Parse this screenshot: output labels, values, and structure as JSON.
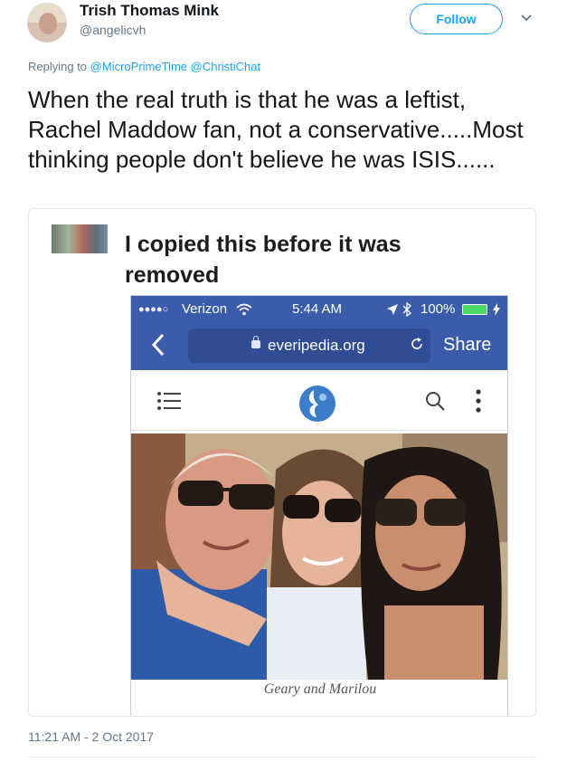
{
  "author": {
    "name": "Trish Thomas Mink",
    "handle": "@angelicvh"
  },
  "follow_label": "Follow",
  "replying": {
    "prefix": "Replying to",
    "users": [
      "@MicroPrimeTime",
      "@ChristiChat"
    ]
  },
  "tweet": {
    "text": "When the real truth is that he was a leftist, Rachel Maddow fan, not a conservative.....Most thinking people don't believe he was ISIS......",
    "timestamp": "11:21 AM - 2 Oct 2017"
  },
  "media": {
    "caption": "I copied this before it was removed",
    "phone": {
      "carrier": "Verizon",
      "signal_dots": "●●●●○",
      "time": "5:44 AM",
      "battery": "100%",
      "url": "everipedia.org",
      "share_label": "Share",
      "photo_caption": "Geary and Marilou"
    }
  },
  "colors": {
    "twitter_blue": "#1da1f2",
    "facebook_blue": "#3b5bab",
    "muted_text": "#657786"
  },
  "icons": [
    "chevron-down-icon",
    "back-chevron-icon",
    "lock-icon",
    "reload-icon",
    "menu-list-icon",
    "everipedia-logo-icon",
    "search-icon",
    "kebab-menu-icon"
  ]
}
